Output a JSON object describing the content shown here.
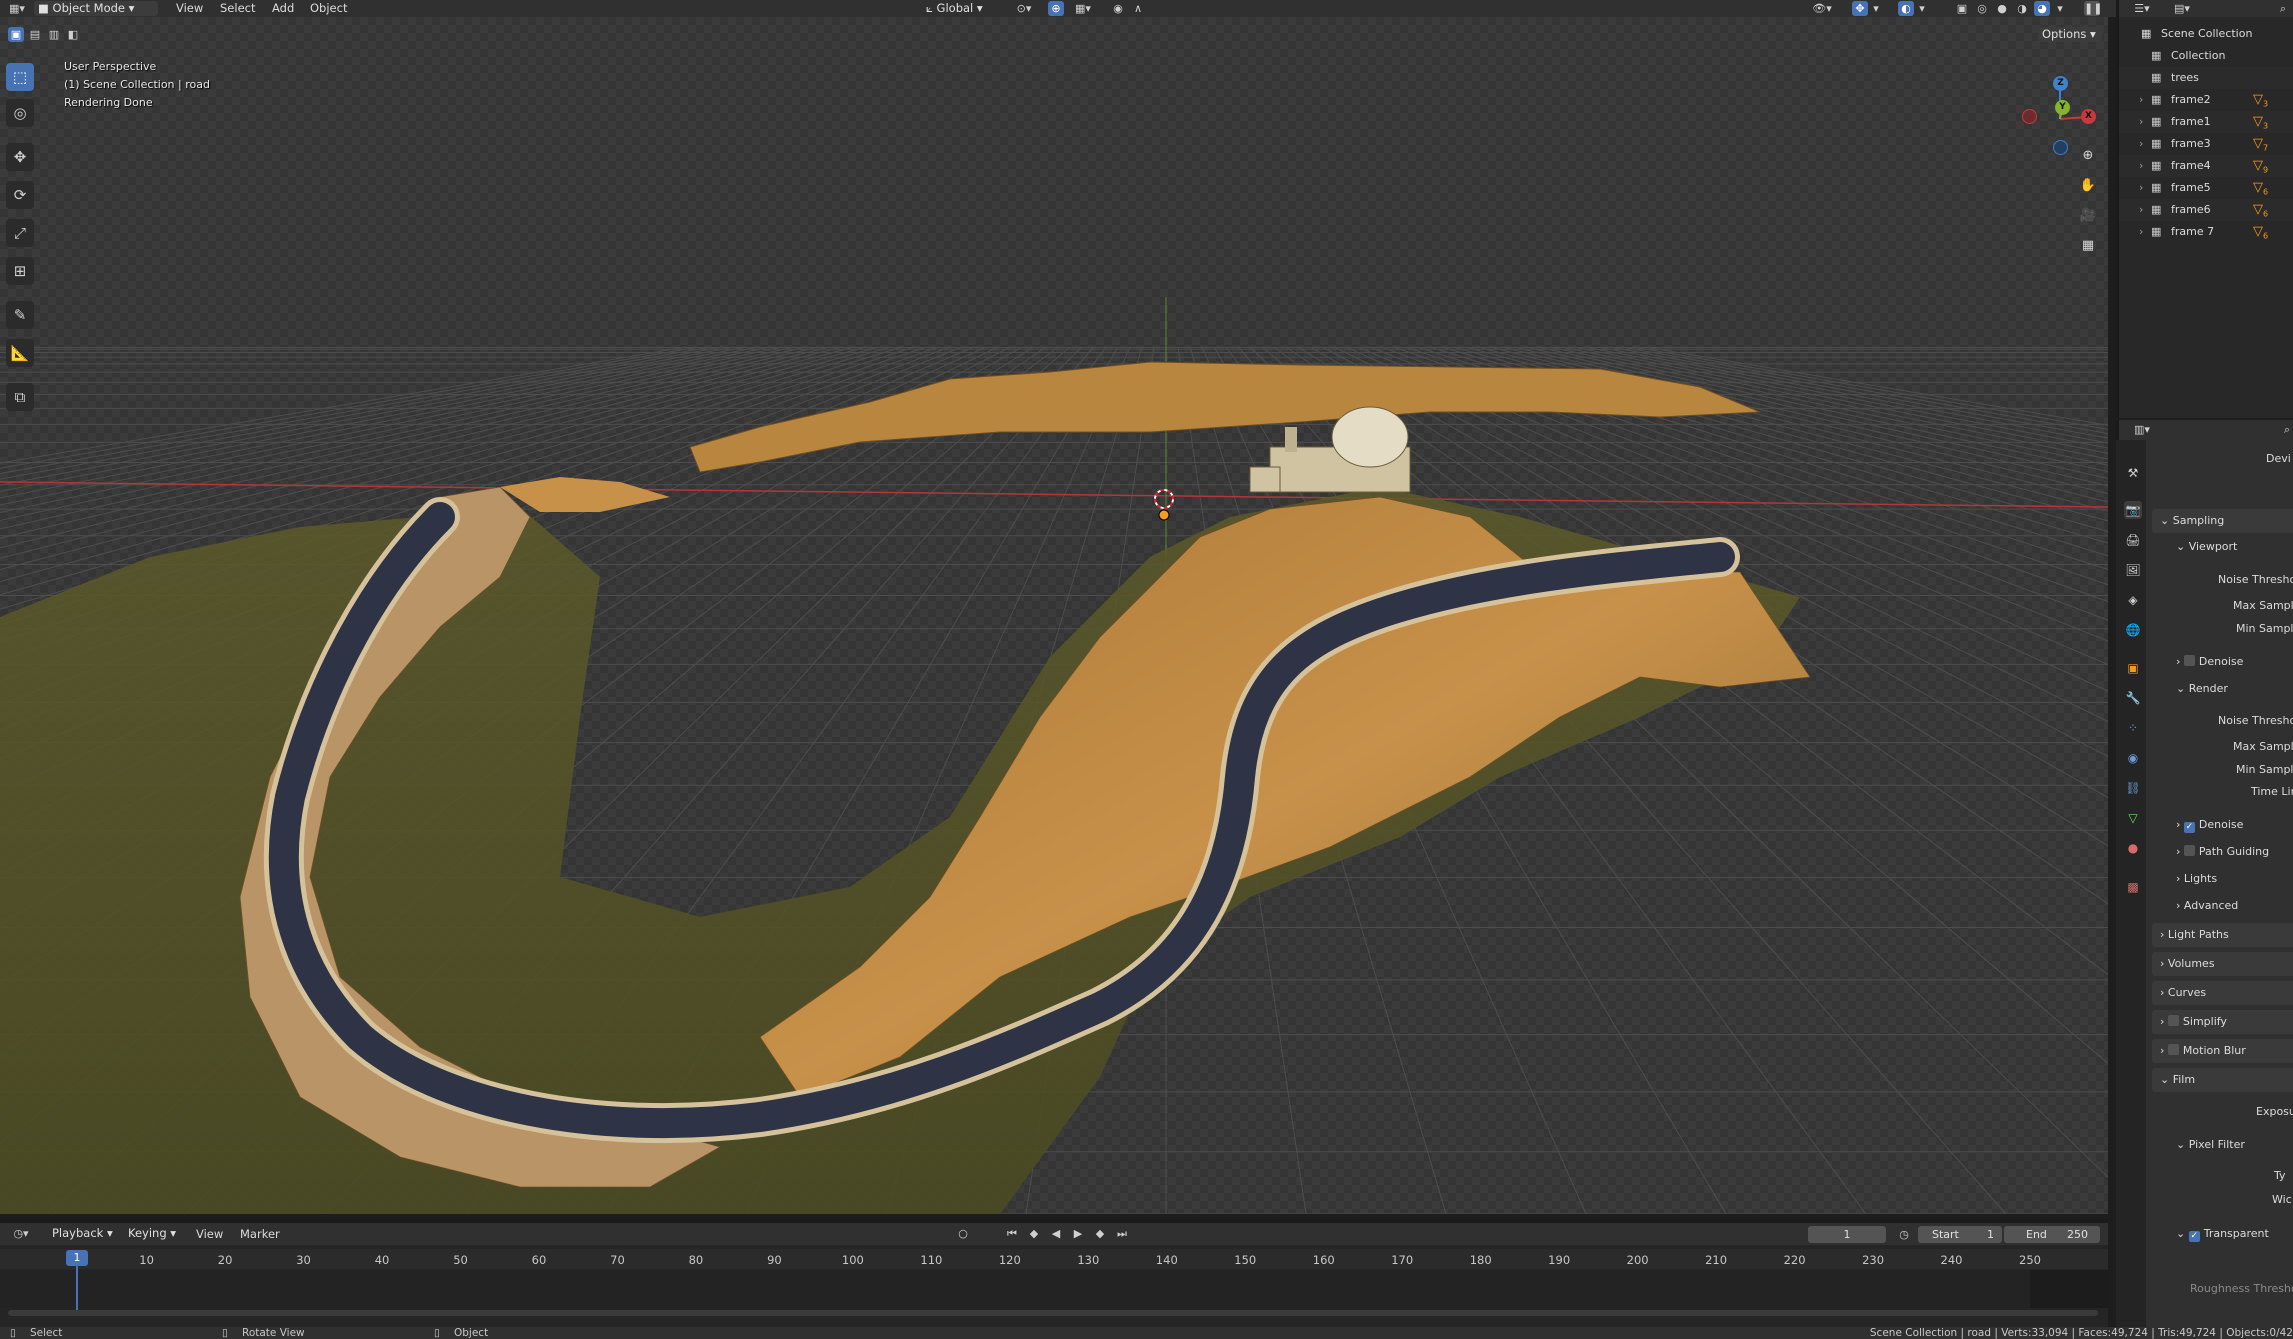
{
  "header": {
    "mode": "Object Mode",
    "menus": [
      "View",
      "Select",
      "Add",
      "Object"
    ],
    "transform_orientation": "Global",
    "options_label": "Options"
  },
  "viewport": {
    "perspective": "User Perspective",
    "collection_info": "(1) Scene Collection | road",
    "render_status": "Rendering Done"
  },
  "gizmo": {
    "z": "Z",
    "x": "X",
    "y": "Y"
  },
  "outliner": {
    "root": "Scene Collection",
    "items": [
      {
        "label": "Collection",
        "badge": ""
      },
      {
        "label": "trees",
        "badge": ""
      },
      {
        "label": "frame2",
        "badge": "3"
      },
      {
        "label": "frame1",
        "badge": "3"
      },
      {
        "label": "frame3",
        "badge": "7"
      },
      {
        "label": "frame4",
        "badge": "9"
      },
      {
        "label": "frame5",
        "badge": "6"
      },
      {
        "label": "frame6",
        "badge": "6"
      },
      {
        "label": "frame 7",
        "badge": "6"
      }
    ]
  },
  "properties": {
    "device_label": "Devi",
    "sampling": "Sampling",
    "viewport": "Viewport",
    "noise_threshold": "Noise Thresho",
    "max_samples": "Max Sampl",
    "min_samples": "Min Sampl",
    "denoise": "Denoise",
    "render": "Render",
    "time_limit": "Time Lin",
    "path_guiding": "Path Guiding",
    "lights": "Lights",
    "advanced": "Advanced",
    "light_paths": "Light Paths",
    "volumes": "Volumes",
    "curves": "Curves",
    "simplify": "Simplify",
    "motion_blur": "Motion Blur",
    "film": "Film",
    "exposure": "Exposu",
    "pixel_filter": "Pixel Filter",
    "type": "Ty",
    "width": "Wic",
    "transparent": "Transparent",
    "roughness_threshold": "Roughness Thresho"
  },
  "timeline": {
    "menus": [
      "Playback",
      "Keying",
      "View",
      "Marker"
    ],
    "current_frame": "1",
    "start_label": "Start",
    "start": "1",
    "end_label": "End",
    "end": "250",
    "frame_ticks": [
      "1",
      "10",
      "20",
      "30",
      "40",
      "50",
      "60",
      "70",
      "80",
      "90",
      "100",
      "110",
      "120",
      "130",
      "140",
      "150",
      "160",
      "170",
      "180",
      "190",
      "200",
      "210",
      "220",
      "230",
      "240",
      "250"
    ]
  },
  "statusbar": {
    "select": "Select",
    "rotate": "Rotate View",
    "object": "Object",
    "stats": "Scene Collection | road | Verts:33,094 | Faces:49,724 | Tris:49,724 | Objects:0/42"
  },
  "colors": {
    "accent": "#4772b3",
    "terrain": "#c8914a",
    "road": "#2e3346",
    "grid": "#4a4a4a",
    "x_axis": "#c8393e",
    "y_axis": "#86b32d",
    "z_axis": "#3f82d0"
  }
}
